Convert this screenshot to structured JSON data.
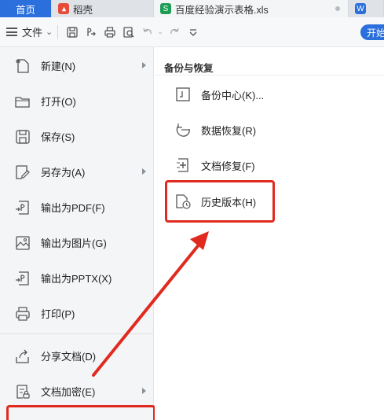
{
  "tabs": [
    {
      "label": "首页",
      "icon": "home"
    },
    {
      "label": "稻壳",
      "icon": "docer-icon"
    },
    {
      "label": "百度经验演示表格.xls",
      "icon": "spreadsheet-icon"
    },
    {
      "label": "",
      "icon": "word-icon"
    }
  ],
  "toolbar": {
    "file_label": "文件",
    "open_label": "开始",
    "icons": [
      "save-icon",
      "export-icon",
      "print-icon",
      "print-preview-icon",
      "undo-icon",
      "redo-icon",
      "more-icon"
    ]
  },
  "left_menu": {
    "items": [
      {
        "label": "新建(N)",
        "icon": "new-doc-icon",
        "submenu": true
      },
      {
        "label": "打开(O)",
        "icon": "folder-icon",
        "submenu": false
      },
      {
        "label": "保存(S)",
        "icon": "save-icon",
        "submenu": false
      },
      {
        "label": "另存为(A)",
        "icon": "save-as-icon",
        "submenu": true
      },
      {
        "label": "输出为PDF(F)",
        "icon": "pdf-icon",
        "submenu": false
      },
      {
        "label": "输出为图片(G)",
        "icon": "image-icon",
        "submenu": false
      },
      {
        "label": "输出为PPTX(X)",
        "icon": "pptx-icon",
        "submenu": false
      },
      {
        "label": "打印(P)",
        "icon": "print-icon",
        "submenu": false
      },
      {
        "label": "分享文档(D)",
        "icon": "share-icon",
        "submenu": false
      },
      {
        "label": "文档加密(E)",
        "icon": "encrypt-icon",
        "submenu": true
      }
    ]
  },
  "right_panel": {
    "title": "备份与恢复",
    "items": [
      {
        "label": "备份中心(K)...",
        "icon": "backup-center-icon"
      },
      {
        "label": "数据恢复(R)",
        "icon": "data-recovery-icon"
      },
      {
        "label": "文档修复(F)",
        "icon": "doc-repair-icon"
      },
      {
        "label": "历史版本(H)",
        "icon": "history-version-icon"
      }
    ]
  },
  "colors": {
    "accent": "#2a6fdb",
    "highlight": "#e02a1f",
    "menu_bg": "#f4f5f7"
  }
}
